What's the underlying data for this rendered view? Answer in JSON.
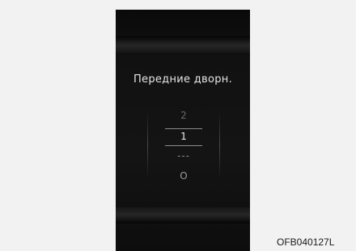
{
  "display": {
    "title": "Передние дворн.",
    "options": {
      "upper": "2",
      "selected": "1",
      "middle": "---",
      "lower": "O"
    }
  },
  "figure_code": "OFB040127L"
}
